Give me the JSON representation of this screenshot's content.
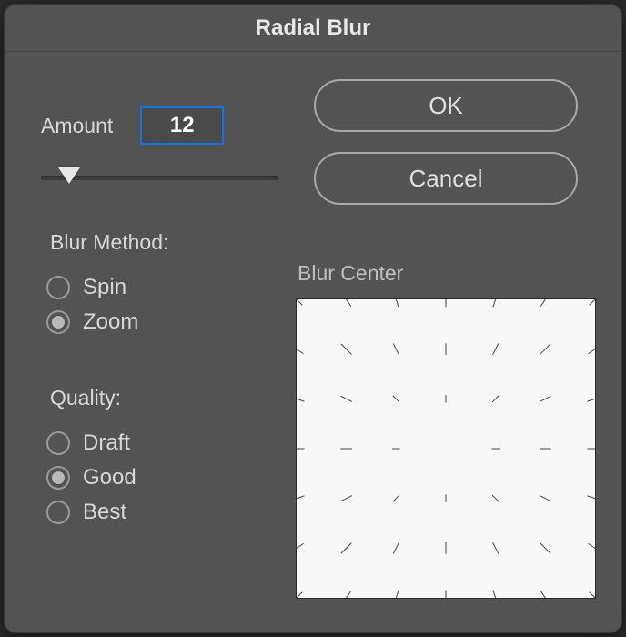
{
  "dialog": {
    "title": "Radial Blur"
  },
  "amount": {
    "label": "Amount",
    "value": "12",
    "sliderPercent": 12
  },
  "buttons": {
    "ok": "OK",
    "cancel": "Cancel"
  },
  "blurMethod": {
    "title": "Blur Method:",
    "options": [
      {
        "label": "Spin",
        "selected": false
      },
      {
        "label": "Zoom",
        "selected": true
      }
    ]
  },
  "quality": {
    "title": "Quality:",
    "options": [
      {
        "label": "Draft",
        "selected": false
      },
      {
        "label": "Good",
        "selected": true
      },
      {
        "label": "Best",
        "selected": false
      }
    ]
  },
  "blurCenter": {
    "label": "Blur Center"
  }
}
